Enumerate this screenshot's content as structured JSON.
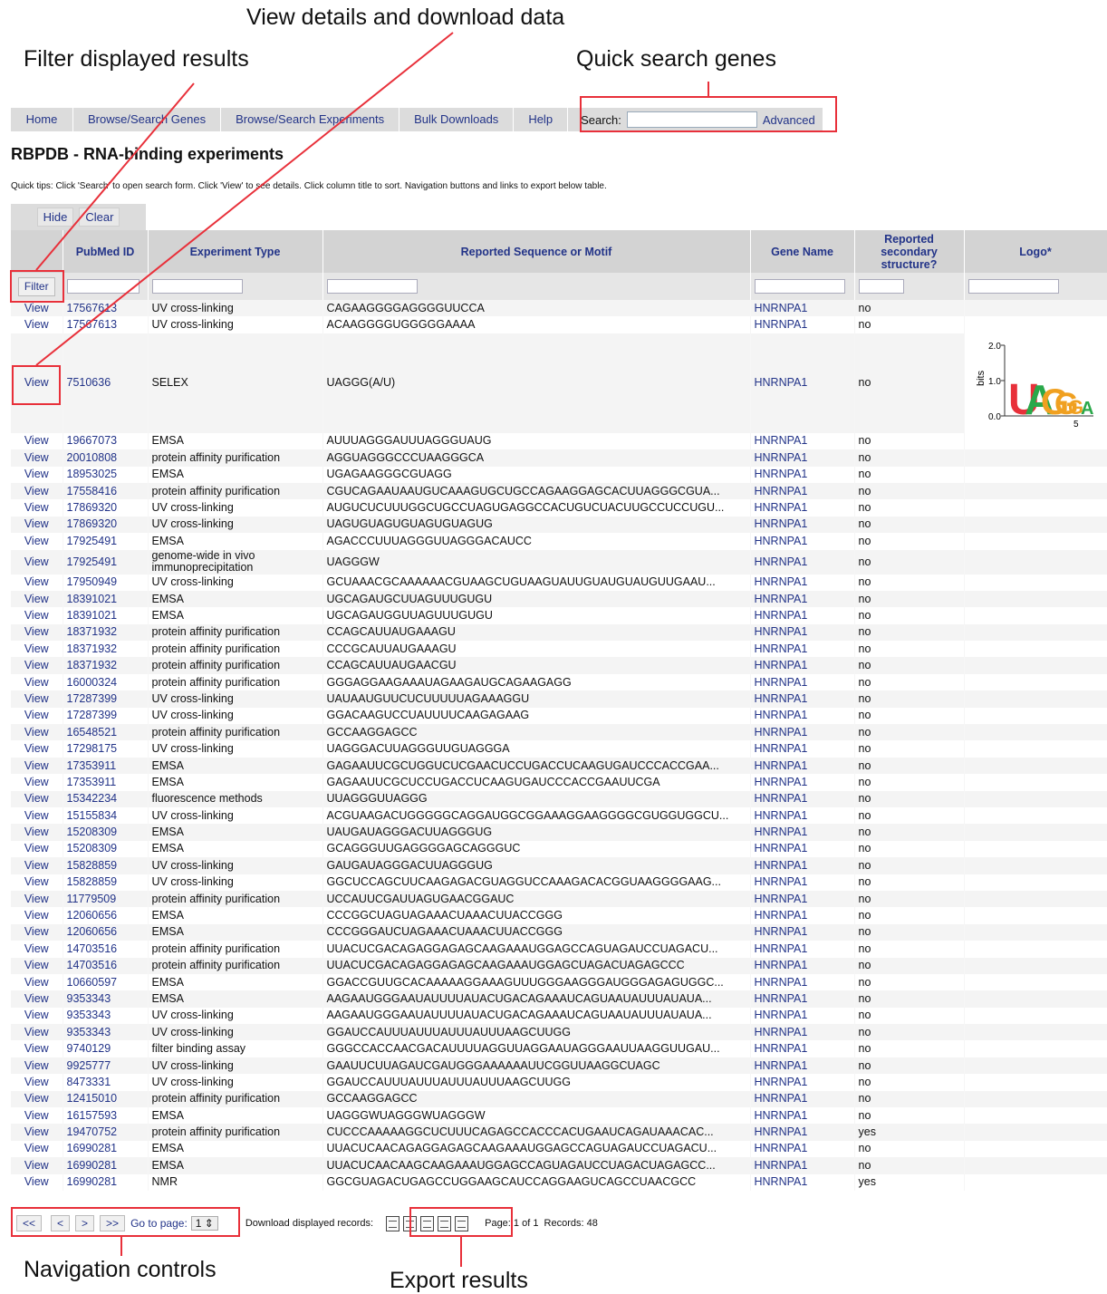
{
  "callouts": {
    "view": "View details and download data",
    "filter": "Filter displayed results",
    "quick": "Quick search genes",
    "navigation": "Navigation controls",
    "export": "Export results"
  },
  "nav": {
    "tabs": [
      "Home",
      "Browse/Search Genes",
      "Browse/Search Experiments",
      "Bulk Downloads",
      "Help"
    ],
    "search_label": "Search:",
    "search_value": "",
    "advanced": "Advanced"
  },
  "title": "RBPDB - RNA-binding experiments",
  "tips": "Quick tips: Click 'Search' to open search form. Click 'View' to see details. Click column title to sort. Navigation buttons and links to export below table.",
  "controls": {
    "hide": "Hide",
    "clear": "Clear",
    "filter": "Filter"
  },
  "table": {
    "headers": [
      "",
      "PubMed ID",
      "Experiment Type",
      "Reported Sequence or Motif",
      "Gene Name",
      "Reported secondary structure?",
      "Logo*"
    ],
    "view_label": "View",
    "rows": [
      [
        "17567613",
        "UV cross-linking",
        "CAGAAGGGGAGGGGUUCCA",
        "HNRNPA1",
        "no"
      ],
      [
        "17567613",
        "UV cross-linking",
        "ACAAGGGGUGGGGGAAAA",
        "HNRNPA1",
        "no"
      ],
      [
        "7510636",
        "SELEX",
        "UAGGG(A/U)",
        "HNRNPA1",
        "no"
      ],
      [
        "19667073",
        "EMSA",
        "AUUUAGGGAUUUAGGGUAUG",
        "HNRNPA1",
        "no"
      ],
      [
        "20010808",
        "protein affinity purification",
        "AGGUAGGGCCCUAAGGGCA",
        "HNRNPA1",
        "no"
      ],
      [
        "18953025",
        "EMSA",
        "UGAGAAGGGCGUAGG",
        "HNRNPA1",
        "no"
      ],
      [
        "17558416",
        "protein affinity purification",
        "CGUCAGAAUAAUGUCAAAGUGCUGCCAGAAGGAGCACUUAGGGCGUA...",
        "HNRNPA1",
        "no"
      ],
      [
        "17869320",
        "UV cross-linking",
        "AUGUCUCUUUGGCUGCCUAGUGAGGCCACUGUCUACUUGCCUCCUGU...",
        "HNRNPA1",
        "no"
      ],
      [
        "17869320",
        "UV cross-linking",
        "UAGUGUAGUGUAGUGUAGUG",
        "HNRNPA1",
        "no"
      ],
      [
        "17925491",
        "EMSA",
        "AGACCCUUUAGGGUUAGGGACAUCC",
        "HNRNPA1",
        "no"
      ],
      [
        "17925491",
        "genome-wide in vivo immunoprecipitation",
        "UAGGGW",
        "HNRNPA1",
        "no"
      ],
      [
        "17950949",
        "UV cross-linking",
        "GCUAAACGCAAAAAACGUAAGCUGUAAGUAUUGUAUGUAUGUUGAAU...",
        "HNRNPA1",
        "no"
      ],
      [
        "18391021",
        "EMSA",
        "UGCAGAUGCUUAGUUUGUGU",
        "HNRNPA1",
        "no"
      ],
      [
        "18391021",
        "EMSA",
        "UGCAGAUGGUUAGUUUGUGU",
        "HNRNPA1",
        "no"
      ],
      [
        "18371932",
        "protein affinity purification",
        "CCAGCAUUAUGAAAGU",
        "HNRNPA1",
        "no"
      ],
      [
        "18371932",
        "protein affinity purification",
        "CCCGCAUUAUGAAAGU",
        "HNRNPA1",
        "no"
      ],
      [
        "18371932",
        "protein affinity purification",
        "CCAGCAUUAUGAACGU",
        "HNRNPA1",
        "no"
      ],
      [
        "16000324",
        "protein affinity purification",
        "GGGAGGAAGAAAUAGAAGAUGCAGAAGAGG",
        "HNRNPA1",
        "no"
      ],
      [
        "17287399",
        "UV cross-linking",
        "UAUAAUGUUCUCUUUUUAGAAAGGU",
        "HNRNPA1",
        "no"
      ],
      [
        "17287399",
        "UV cross-linking",
        "GGACAAGUCCUAUUUUCAAGAGAAG",
        "HNRNPA1",
        "no"
      ],
      [
        "16548521",
        "protein affinity purification",
        "GCCAAGGAGCC",
        "HNRNPA1",
        "no"
      ],
      [
        "17298175",
        "UV cross-linking",
        "UAGGGACUUAGGGUUGUAGGGA",
        "HNRNPA1",
        "no"
      ],
      [
        "17353911",
        "EMSA",
        "GAGAAUUCGCUGGUCUCGAACUCCUGACCUCAAGUGAUCCCACCGAA...",
        "HNRNPA1",
        "no"
      ],
      [
        "17353911",
        "EMSA",
        "GAGAAUUCGCUCCUGACCUCAAGUGAUCCCACCGAAUUCGA",
        "HNRNPA1",
        "no"
      ],
      [
        "15342234",
        "fluorescence methods",
        "UUAGGGUUAGGG",
        "HNRNPA1",
        "no"
      ],
      [
        "15155834",
        "UV cross-linking",
        "ACGUAAGACUGGGGGCAGGAUGGCGGAAAGGAAGGGGCGUGGUGGCU...",
        "HNRNPA1",
        "no"
      ],
      [
        "15208309",
        "EMSA",
        "UAUGAUAGGGACUUAGGGUG",
        "HNRNPA1",
        "no"
      ],
      [
        "15208309",
        "EMSA",
        "GCAGGGUUGAGGGGAGCAGGGUC",
        "HNRNPA1",
        "no"
      ],
      [
        "15828859",
        "UV cross-linking",
        "GAUGAUAGGGACUUAGGGUG",
        "HNRNPA1",
        "no"
      ],
      [
        "15828859",
        "UV cross-linking",
        "GGCUCCAGCUUCAAGAGACGUAGGUCCAAAGACACGGUAAGGGGAAG...",
        "HNRNPA1",
        "no"
      ],
      [
        "11779509",
        "protein affinity purification",
        "UCCAUUCGAUUAGUGAACGGAUC",
        "HNRNPA1",
        "no"
      ],
      [
        "12060656",
        "EMSA",
        "CCCGGCUAGUAGAAACUAAACUUACCGGG",
        "HNRNPA1",
        "no"
      ],
      [
        "12060656",
        "EMSA",
        "CCCGGGAUCUAGAAACUAAACUUACCGGG",
        "HNRNPA1",
        "no"
      ],
      [
        "14703516",
        "protein affinity purification",
        "UUACUCGACAGAGGAGAGCAAGAAAUGGAGCCAGUAGAUCCUAGACU...",
        "HNRNPA1",
        "no"
      ],
      [
        "14703516",
        "protein affinity purification",
        "UUACUCGACAGAGGAGAGCAAGAAAUGGAGCUAGACUAGAGCCC",
        "HNRNPA1",
        "no"
      ],
      [
        "10660597",
        "EMSA",
        "GGACCGUUGCACAAAAAGGAAAGUUUGGGAAGGGAUGGGAGAGUGGC...",
        "HNRNPA1",
        "no"
      ],
      [
        "9353343",
        "EMSA",
        "AAGAAUGGGAAUAUUUUAUACUGACAGAAAUCAGUAAUAUUUAUAUA...",
        "HNRNPA1",
        "no"
      ],
      [
        "9353343",
        "UV cross-linking",
        "AAGAAUGGGAAUAUUUUAUACUGACAGAAAUCAGUAAUAUUUAUAUA...",
        "HNRNPA1",
        "no"
      ],
      [
        "9353343",
        "UV cross-linking",
        "GGAUCCAUUUAUUUAUUUAUUUAAGCUUGG",
        "HNRNPA1",
        "no"
      ],
      [
        "9740129",
        "filter binding assay",
        "GGGCCACCAACGACAUUUUAGGUUAGGAAUAGGGAAUUAAGGUUGAU...",
        "HNRNPA1",
        "no"
      ],
      [
        "9925777",
        "UV cross-linking",
        "GAAUUCUUAGAUCGAUGGGAAAAAAUUCGGUUAAGGCUAGC",
        "HNRNPA1",
        "no"
      ],
      [
        "8473331",
        "UV cross-linking",
        "GGAUCCAUUUAUUUAUUUAUUUAAGCUUGG",
        "HNRNPA1",
        "no"
      ],
      [
        "12415010",
        "protein affinity purification",
        "GCCAAGGAGCC",
        "HNRNPA1",
        "no"
      ],
      [
        "16157593",
        "EMSA",
        "UAGGGWUAGGGWUAGGGW",
        "HNRNPA1",
        "no"
      ],
      [
        "19470752",
        "protein affinity purification",
        "CUCCCAAAAAGGCUCUUUCAGAGCCACCCACUGAAUCAGAUAAACAC...",
        "HNRNPA1",
        "yes"
      ],
      [
        "16990281",
        "EMSA",
        "UUACUCAACAGAGGAGAGCAAGAAAUGGAGCCAGUAGAUCCUAGACU...",
        "HNRNPA1",
        "no"
      ],
      [
        "16990281",
        "EMSA",
        "UUACUCAACAAGCAAGAAAUGGAGCCAGUAGAUCCUAGACUAGAGCC...",
        "HNRNPA1",
        "no"
      ],
      [
        "16990281",
        "NMR",
        "GGCGUAGACUGAGCCUGGAAGCAUCCAGGAAGUCAGCCUAACGCC",
        "HNRNPA1",
        "yes"
      ]
    ]
  },
  "logo": {
    "ylabel": "bits",
    "ticks": [
      "2.0",
      "1.0",
      "0.0"
    ],
    "xtick": "5",
    "letters": [
      "U",
      "A",
      "G",
      "G",
      "G",
      "A"
    ],
    "colors": {
      "U": "#e8303a",
      "A": "#2aa84a",
      "G": "#f0a020",
      "C": "#2040c0"
    }
  },
  "footer": {
    "first": "<<",
    "prev": "<",
    "next": ">",
    "last": ">>",
    "goto": "Go to page:",
    "page": "1",
    "download": "Download displayed records:",
    "status": "Page: 1 of 1  Records: 48"
  }
}
